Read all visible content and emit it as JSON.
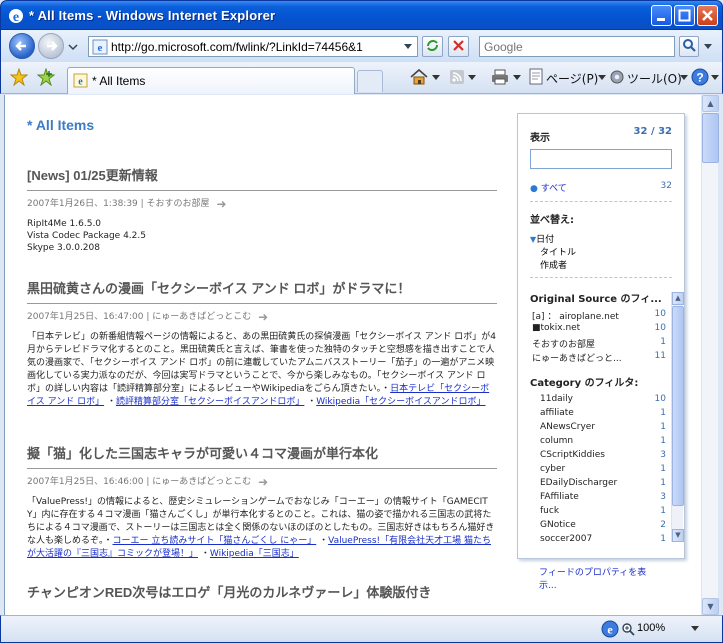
{
  "window": {
    "title": "* All Items - Windows Internet Explorer"
  },
  "address": {
    "url": "http://go.microsoft.com/fwlink/?LinkId=74456&1",
    "search_placeholder": "Google"
  },
  "tabs": [
    {
      "label": "* All Items"
    }
  ],
  "commands": {
    "page": "ページ(P)",
    "tools": "ツール(O)"
  },
  "page": {
    "heading": "* All Items"
  },
  "articles": [
    {
      "title": "[News] 01/25更新情報",
      "date": "2007年1月26日、1:38:39",
      "source": "そおすのお部屋",
      "lines": [
        "RipIt4Me 1.6.5.0",
        "Vista Codec Package 4.2.5",
        "Skype 3.0.0.208"
      ]
    },
    {
      "title": "黒田硫黄さんの漫画「セクシーボイス アンド ロボ」がドラマに！",
      "date": "2007年1月25日、16:47:00",
      "source": "にゅーあきばどっとこむ",
      "body": "「日本テレビ」の新番組情報ページの情報によると、あの黒田硫黄氏の探偵漫画「セクシーボイス アンド ロボ」が4月からテレビドラマ化するとのこと。黒田硫黄氏と言えば、筆書を使った独特のタッチと空想感を描き出すことで人気の漫画家で、「セクシーボイス アンド ロボ」の前に連載していたアムニバスストーリー「茄子」の一遍がアニメ映画化している実力派なのだが、今回は実写ドラマということで、今から楽しみなもの。「セクシーボイス アンド ロボ」の詳しい内容は「読評精算部分室」によるレビューやWikipediaをごらん頂きたい。・",
      "links": [
        "日本テレビ「セクシーボイス アンド ロボ」",
        "読評精算部分室「セクシーボイスアンドロボ」",
        "Wikipedia「セクシーボイスアンドロボ」"
      ]
    },
    {
      "title": "擬「猫」化した三国志キャラが可愛い４コマ漫画が単行本化",
      "date": "2007年1月25日、16:46:00",
      "source": "にゅーあきばどっとこむ",
      "body": "「ValuePress!」の情報によると、歴史シミュレーションゲームでおなじみ「コーエー」の情報サイト「GAMECITY」内に存在する４コマ漫画「猫さんごくし」が単行本化するとのこと。これは、猫の姿で描かれる三国志の武将たちによる４コマ漫画で、ストーリーは三国志とは全く関係のないほのぼのとしたもの。三国志好きはもちろん猫好きな人も楽しめるぞ。・",
      "links": [
        "コーエー 立ち読みサイト「猫さんごくし にゃー」",
        "ValuePress!「有限会社天才工場 猫たちが大活躍の『三国志』コミックが登場！」",
        "Wikipedia「三国志」"
      ]
    },
    {
      "title": "チャンピオンRED次号はエロゲ「月光のカルネヴァーレ」体験版付き"
    }
  ],
  "panel": {
    "display_label": "表示",
    "count": "32 / 32",
    "all_label": "すべて",
    "all_count": "32",
    "sort_label": "並べ替え:",
    "sort_options": [
      "日付",
      "タイトル",
      "作成者"
    ],
    "source_label": "Original Source のフィ...",
    "sources": [
      {
        "name": "[a] ： airoplane.net",
        "count": "10"
      },
      {
        "name": "■tokix.net",
        "count": "10"
      },
      {
        "name": "そおすのお部屋",
        "count": "1"
      },
      {
        "name": "にゅーあきばどっと...",
        "count": "11"
      }
    ],
    "category_label": "Category のフィルタ:",
    "categories": [
      {
        "name": "11daily",
        "count": "10"
      },
      {
        "name": "affiliate",
        "count": "1"
      },
      {
        "name": "ANewsCryer",
        "count": "1"
      },
      {
        "name": "column",
        "count": "1"
      },
      {
        "name": "CScriptKiddies",
        "count": "3"
      },
      {
        "name": "cyber",
        "count": "1"
      },
      {
        "name": "EDailyDischarger",
        "count": "1"
      },
      {
        "name": "FAffiliate",
        "count": "3"
      },
      {
        "name": "fuck",
        "count": "1"
      },
      {
        "name": "GNotice",
        "count": "2"
      },
      {
        "name": "soccer2007",
        "count": "1"
      }
    ],
    "feed_properties": "フィードのプロパティを表示..."
  },
  "status": {
    "zoom": "100%"
  }
}
